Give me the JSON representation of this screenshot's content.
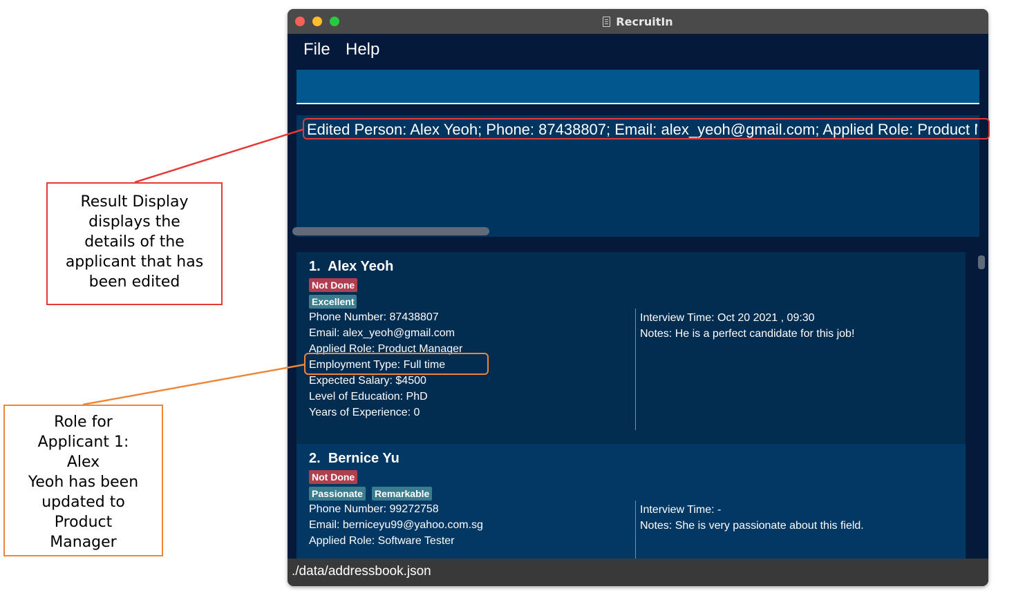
{
  "window": {
    "title": "RecruitIn",
    "traffic_light_colors": [
      "#fe5f57",
      "#febc2e",
      "#28c840"
    ]
  },
  "menu": {
    "file": "File",
    "help": "Help"
  },
  "command_box": {
    "value": ""
  },
  "result_display": {
    "text": "Edited Person: Alex Yeoh; Phone: 87438807; Email: alex_yeoh@gmail.com; Applied Role: Product Manager"
  },
  "applicants": [
    {
      "index": "1.",
      "name": "Alex Yeoh",
      "status_tag": "Not Done",
      "tags": [
        "Excellent"
      ],
      "phone": "Phone Number: 87438807",
      "email": "Email: alex_yeoh@gmail.com",
      "role": "Applied Role: Product Manager",
      "employment_type": "Employment Type: Full time",
      "salary": "Expected Salary: $4500",
      "education": "Level of Education: PhD",
      "experience": "Years of Experience: 0",
      "interview_time": "Interview Time: Oct 20 2021 , 09:30",
      "notes": "Notes: He is a perfect candidate for this job!"
    },
    {
      "index": "2.",
      "name": "Bernice Yu",
      "status_tag": "Not Done",
      "tags": [
        "Passionate",
        "Remarkable"
      ],
      "phone": "Phone Number: 99272758",
      "email": "Email: berniceyu99@yahoo.com.sg",
      "role": "Applied Role: Software Tester",
      "interview_time": "Interview Time: -",
      "notes": "Notes: She is very passionate about this field."
    }
  ],
  "status_bar": {
    "path": "./data/addressbook.json"
  },
  "annotations": {
    "result_display": [
      "Result Display",
      "displays the",
      "details of the",
      "applicant that has",
      "been edited"
    ],
    "role_update": [
      "Role for",
      "Applicant 1:",
      "Alex",
      "Yeoh has been",
      "updated to",
      "Product",
      "Manager"
    ],
    "colors": {
      "result": "#e53935",
      "role": "#ef8536"
    }
  }
}
